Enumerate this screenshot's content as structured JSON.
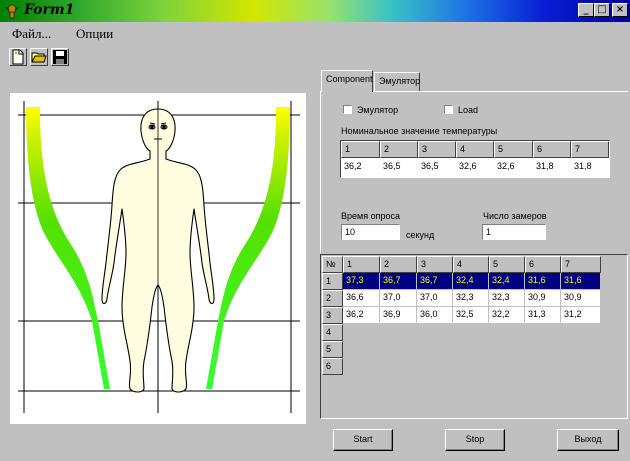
{
  "window": {
    "title": "Form1",
    "buttons": {
      "minimize": "_",
      "maximize": "□",
      "close": "×"
    }
  },
  "menu": {
    "file": "Файл...",
    "options": "Опции"
  },
  "toolbar": {
    "icons": [
      "new-file-icon",
      "open-folder-icon",
      "save-disk-icon"
    ]
  },
  "tabs": {
    "component": "Component",
    "emulator": "Эмулятор"
  },
  "component": {
    "emulator_checkbox_label": "Эмулятор",
    "emulator_checked": false,
    "load_checkbox_label": "Load",
    "load_checked": false,
    "nominal_temp_label": "Номинальное значение температуры",
    "nominal_headers": [
      "1",
      "2",
      "3",
      "4",
      "5",
      "6",
      "7"
    ],
    "nominal_values": [
      "36,2",
      "36,5",
      "36,5",
      "32,6",
      "32,6",
      "31,8",
      "31,8"
    ],
    "poll_time_label": "Время опроса",
    "poll_time_value": "10",
    "poll_time_unit": "секунд",
    "measure_count_label": "Число замеров",
    "measure_count_value": "1"
  },
  "results": {
    "corner_header": "№",
    "column_headers": [
      "1",
      "2",
      "3",
      "4",
      "5",
      "6",
      "7"
    ],
    "row_headers": [
      "1",
      "2",
      "3",
      "4",
      "5",
      "6"
    ],
    "rows": [
      [
        "37,3",
        "36,7",
        "36,7",
        "32,4",
        "32,4",
        "31,6",
        "31,6"
      ],
      [
        "36,6",
        "37,0",
        "37,0",
        "32,3",
        "32,3",
        "30,9",
        "30,9"
      ],
      [
        "36,2",
        "36,9",
        "36,0",
        "32,5",
        "32,2",
        "31,3",
        "31,2"
      ],
      [
        "",
        "",
        "",
        "",
        "",
        "",
        ""
      ],
      [
        "",
        "",
        "",
        "",
        "",
        "",
        ""
      ],
      [
        "",
        "",
        "",
        "",
        "",
        "",
        ""
      ]
    ],
    "selected_row": 1
  },
  "buttons": {
    "start": "Start",
    "stop": "Stop",
    "exit": "Выход"
  },
  "colors": {
    "gradient_top": "#ffff00",
    "gradient_mid": "#80e000",
    "gradient_bottom": "#33ff33",
    "selection_bg": "#000080",
    "selection_fg": "#ffff00",
    "body_fill": "#fffde0"
  }
}
